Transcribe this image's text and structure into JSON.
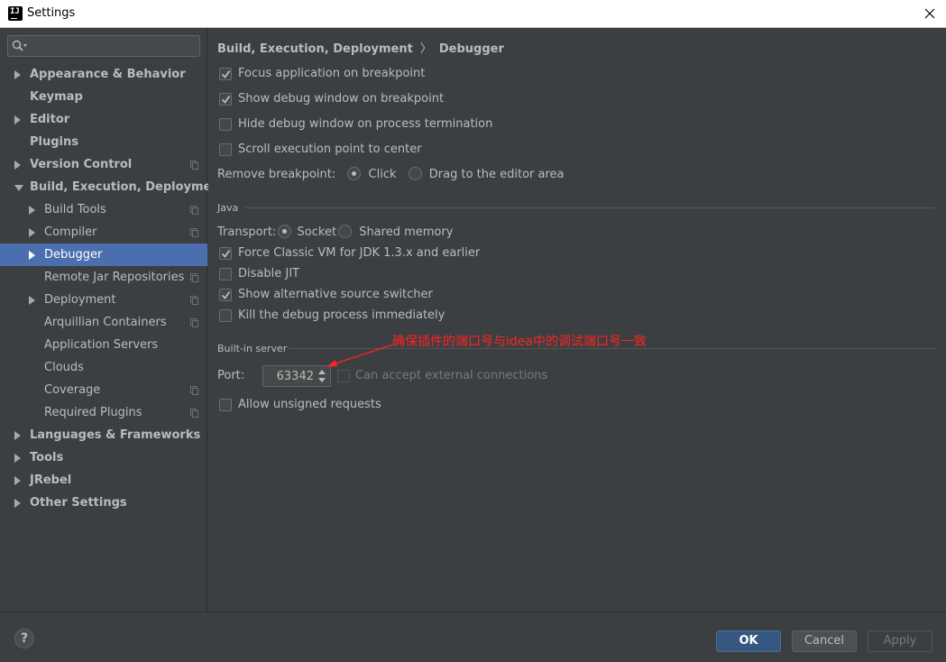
{
  "window": {
    "title": "Settings",
    "app_icon": "intellij-logo-icon",
    "close_icon": "close-icon"
  },
  "search": {
    "placeholder": "",
    "icon": "search-icon"
  },
  "sidebar": {
    "items": [
      {
        "label": "Appearance & Behavior",
        "level": 0,
        "arrow": "right",
        "bold": true
      },
      {
        "label": "Keymap",
        "level": 0,
        "arrow": "none",
        "bold": true
      },
      {
        "label": "Editor",
        "level": 0,
        "arrow": "right",
        "bold": true
      },
      {
        "label": "Plugins",
        "level": 0,
        "arrow": "none",
        "bold": true
      },
      {
        "label": "Version Control",
        "level": 0,
        "arrow": "right",
        "bold": true,
        "copy": true
      },
      {
        "label": "Build, Execution, Deployment",
        "level": 0,
        "arrow": "down",
        "bold": true
      },
      {
        "label": "Build Tools",
        "level": 1,
        "arrow": "right",
        "copy": true
      },
      {
        "label": "Compiler",
        "level": 1,
        "arrow": "right",
        "copy": true
      },
      {
        "label": "Debugger",
        "level": 1,
        "arrow": "right",
        "selected": true
      },
      {
        "label": "Remote Jar Repositories",
        "level": 1,
        "arrow": "none",
        "copy": true
      },
      {
        "label": "Deployment",
        "level": 1,
        "arrow": "right",
        "copy": true
      },
      {
        "label": "Arquillian Containers",
        "level": 1,
        "arrow": "none",
        "copy": true
      },
      {
        "label": "Application Servers",
        "level": 1,
        "arrow": "none"
      },
      {
        "label": "Clouds",
        "level": 1,
        "arrow": "none"
      },
      {
        "label": "Coverage",
        "level": 1,
        "arrow": "none",
        "copy": true
      },
      {
        "label": "Required Plugins",
        "level": 1,
        "arrow": "none",
        "copy": true
      },
      {
        "label": "Languages & Frameworks",
        "level": 0,
        "arrow": "right",
        "bold": true
      },
      {
        "label": "Tools",
        "level": 0,
        "arrow": "right",
        "bold": true
      },
      {
        "label": "JRebel",
        "level": 0,
        "arrow": "right",
        "bold": true
      },
      {
        "label": "Other Settings",
        "level": 0,
        "arrow": "right",
        "bold": true
      }
    ]
  },
  "breadcrumb": {
    "parent": "Build, Execution, Deployment",
    "separator": "〉",
    "current": "Debugger"
  },
  "general": {
    "focus_app": {
      "label": "Focus application on breakpoint",
      "checked": true
    },
    "show_debug": {
      "label": "Show debug window on breakpoint",
      "checked": true
    },
    "hide_debug": {
      "label": "Hide debug window on process termination",
      "checked": false
    },
    "scroll_exec": {
      "label": "Scroll execution point to center",
      "checked": false
    },
    "remove_bp": {
      "label": "Remove breakpoint:",
      "click": "Click",
      "drag": "Drag to the editor area",
      "selected": "Click"
    }
  },
  "java": {
    "section": "Java",
    "transport_label": "Transport:",
    "socket": "Socket",
    "shared_memory": "Shared memory",
    "transport_selected": "Socket",
    "force_classic": {
      "label": "Force Classic VM for JDK 1.3.x and earlier",
      "checked": true
    },
    "disable_jit": {
      "label": "Disable JIT",
      "checked": false
    },
    "alt_source": {
      "label": "Show alternative source switcher",
      "checked": true
    },
    "kill_process": {
      "label": "Kill the debug process immediately",
      "checked": false
    }
  },
  "server": {
    "section": "Built-in server",
    "port_label": "Port:",
    "port_value": "63342",
    "external": {
      "label": "Can accept external connections",
      "checked": false,
      "enabled": false
    },
    "unsigned": {
      "label": "Allow unsigned requests",
      "checked": false
    }
  },
  "annotation": {
    "text": "确保插件的端口号与idea中的调试端口号一致",
    "color": "#ff2222"
  },
  "footer": {
    "help": "?",
    "ok": "OK",
    "cancel": "Cancel",
    "apply": "Apply"
  },
  "colors": {
    "background": "#3c3f41",
    "selection": "#4b6eaf",
    "ok_button": "#365880"
  }
}
